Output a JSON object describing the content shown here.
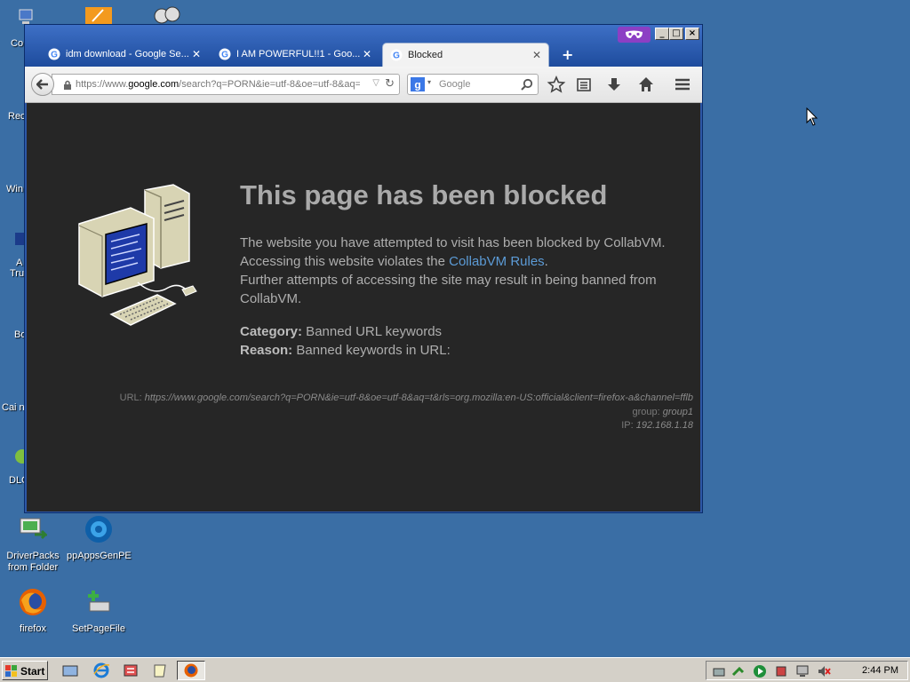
{
  "desktop": {
    "icons": [
      {
        "label": "DriverPacks from Folder"
      },
      {
        "label": "ppAppsGenPE"
      },
      {
        "label": "firefox"
      },
      {
        "label": "SetPageFile"
      }
    ],
    "partial_labels": [
      "Co",
      "Rec",
      "Win",
      "A",
      "Tru",
      "Bo",
      "Cai n",
      "DLC"
    ]
  },
  "browser": {
    "tabs": [
      {
        "label": "idm download - Google Se..."
      },
      {
        "label": "I AM POWERFUL!!1 - Goo..."
      },
      {
        "label": "Blocked"
      }
    ],
    "url": {
      "prefix": "https://www.",
      "domain": "google.com",
      "path": "/search?q=PORN&ie=utf-8&oe=utf-8&aq="
    },
    "search_placeholder": "Google"
  },
  "blocked_page": {
    "title": "This page has been blocked",
    "message_1": "The website you have attempted to visit has been blocked by CollabVM.",
    "message_2_prefix": "Accessing this website violates the ",
    "rules_link": "CollabVM Rules",
    "message_2_suffix": ".",
    "message_3": "Further attempts of accessing the site may result in being banned from CollabVM.",
    "category_label": "Category:",
    "category_value": " Banned URL keywords",
    "reason_label": "Reason:",
    "reason_value": " Banned keywords in URL:",
    "url_label": "URL: ",
    "url_value": "https://www.google.com/search?q=PORN&ie=utf-8&oe=utf-8&aq=t&rls=org.mozilla:en-US:official&client=firefox-a&channel=fflb",
    "group_label": "group: ",
    "group_value": "group1",
    "ip_label": "IP: ",
    "ip_value": "192.168.1.18"
  },
  "taskbar": {
    "start_label": "Start",
    "clock": "2:44 PM"
  },
  "colors": {
    "desktop": "#3a6ea5",
    "page_background": "#262626",
    "link": "#5c9bd6",
    "private_badge": "#8c3fc4"
  }
}
